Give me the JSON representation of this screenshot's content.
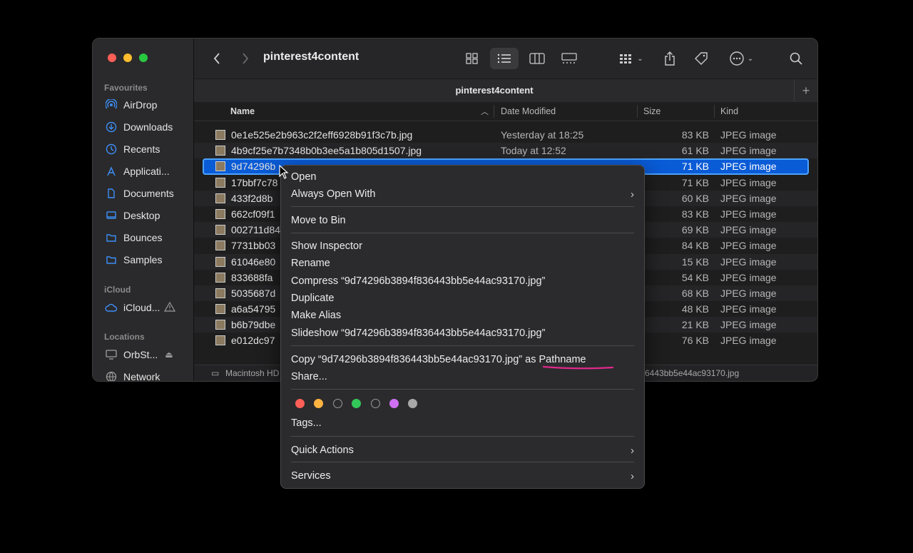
{
  "window": {
    "title": "pinterest4content",
    "tab_title": "pinterest4content",
    "path_bar": {
      "left": "Macintosh HD",
      "right": "6443bb5e44ac93170.jpg"
    }
  },
  "sidebar": {
    "sections": {
      "favourites": "Favourites",
      "icloud": "iCloud",
      "locations": "Locations"
    },
    "favourites": [
      {
        "label": "AirDrop",
        "icon": "airdrop-icon"
      },
      {
        "label": "Downloads",
        "icon": "download-icon"
      },
      {
        "label": "Recents",
        "icon": "clock-icon"
      },
      {
        "label": "Applicati...",
        "icon": "applications-icon"
      },
      {
        "label": "Documents",
        "icon": "document-icon"
      },
      {
        "label": "Desktop",
        "icon": "desktop-icon"
      },
      {
        "label": "Bounces",
        "icon": "folder-icon"
      },
      {
        "label": "Samples",
        "icon": "folder-icon"
      }
    ],
    "icloud": [
      {
        "label": "iCloud...",
        "icon": "cloud-icon",
        "warning": true
      }
    ],
    "locations": [
      {
        "label": "OrbSt...",
        "icon": "display-icon",
        "eject": true
      },
      {
        "label": "Network",
        "icon": "network-icon"
      }
    ]
  },
  "columns": {
    "name": "Name",
    "date": "Date Modified",
    "size": "Size",
    "kind": "Kind"
  },
  "files": [
    {
      "name": "0e1e525e2b963c2f2eff6928b91f3c7b.jpg",
      "date": "Yesterday at 18:25",
      "size": "83 KB",
      "kind": "JPEG image"
    },
    {
      "name": "4b9cf25e7b7348b0b3ee5a1b805d1507.jpg",
      "date": "Today at 12:52",
      "size": "61 KB",
      "kind": "JPEG image"
    },
    {
      "name": "9d74296b",
      "date": "",
      "size": "71 KB",
      "kind": "JPEG image",
      "selected": true
    },
    {
      "name": "17bbf7c78",
      "date": "",
      "size": "71 KB",
      "kind": "JPEG image"
    },
    {
      "name": "433f2d8b",
      "date": "",
      "size": "60 KB",
      "kind": "JPEG image"
    },
    {
      "name": "662cf09f1",
      "date": "",
      "size": "83 KB",
      "kind": "JPEG image"
    },
    {
      "name": "002711d84",
      "date": "",
      "size": "69 KB",
      "kind": "JPEG image"
    },
    {
      "name": "7731bb03",
      "date": "",
      "size": "84 KB",
      "kind": "JPEG image"
    },
    {
      "name": "61046e80",
      "date": "",
      "size": "15 KB",
      "kind": "JPEG image"
    },
    {
      "name": "833688fa",
      "date": "",
      "size": "54 KB",
      "kind": "JPEG image"
    },
    {
      "name": "5035687d",
      "date": "",
      "size": "68 KB",
      "kind": "JPEG image"
    },
    {
      "name": "a6a54795",
      "date": "",
      "size": "48 KB",
      "kind": "JPEG image"
    },
    {
      "name": "b6b79dbe",
      "date": "",
      "size": "21 KB",
      "kind": "JPEG image"
    },
    {
      "name": "e012dc97",
      "date": "",
      "size": "76 KB",
      "kind": "JPEG image"
    }
  ],
  "context_menu": {
    "open": "Open",
    "always_open_with": "Always Open With",
    "move_to_bin": "Move to Bin",
    "show_inspector": "Show Inspector",
    "rename": "Rename",
    "compress": "Compress “9d74296b3894f836443bb5e44ac93170.jpg”",
    "duplicate": "Duplicate",
    "make_alias": "Make Alias",
    "slideshow": "Slideshow “9d74296b3894f836443bb5e44ac93170.jpg”",
    "copy_as_pathname": "Copy “9d74296b3894f836443bb5e44ac93170.jpg” as Pathname",
    "share": "Share...",
    "tags": "Tags...",
    "quick_actions": "Quick Actions",
    "services": "Services",
    "tag_colors": [
      "#ff5f57",
      "#ffb340",
      "none",
      "#34c759",
      "none",
      "#cf6ff2",
      "#a8a8a8"
    ]
  },
  "annotation": {
    "underline_color": "#e0288c"
  }
}
